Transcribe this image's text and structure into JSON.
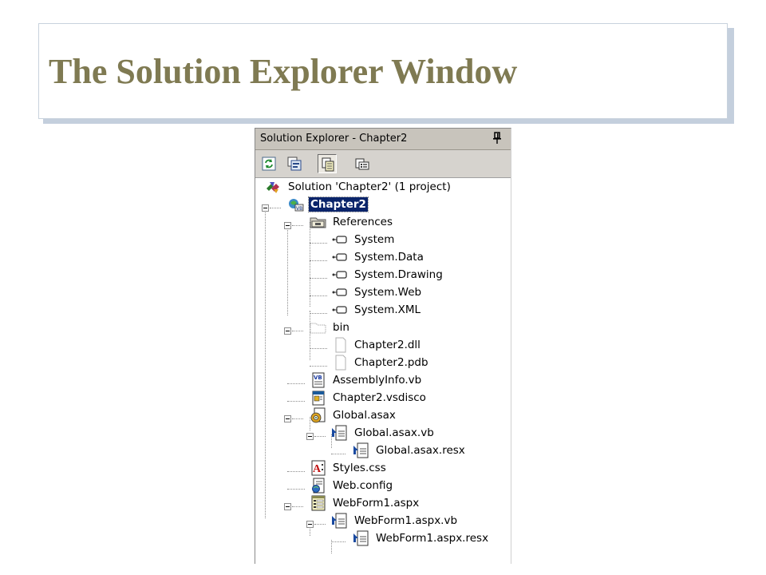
{
  "slide": {
    "title": "The Solution Explorer Window"
  },
  "window": {
    "title": "Solution Explorer - Chapter2",
    "toolbar": [
      {
        "name": "refresh-button",
        "icon": "refresh-icon",
        "active": false
      },
      {
        "name": "view-code-button",
        "icon": "view-code-icon",
        "active": false
      },
      {
        "name": "show-all-files-button",
        "icon": "show-all-files-icon",
        "active": true
      },
      {
        "name": "properties-button",
        "icon": "properties-icon",
        "active": false
      }
    ]
  },
  "tree": {
    "solution": "Solution 'Chapter2' (1 project)",
    "project": "Chapter2",
    "references": {
      "label": "References",
      "items": [
        "System",
        "System.Data",
        "System.Drawing",
        "System.Web",
        "System.XML"
      ]
    },
    "bin": {
      "label": "bin",
      "items": [
        "Chapter2.dll",
        "Chapter2.pdb"
      ]
    },
    "assemblyinfo": "AssemblyInfo.vb",
    "vsdisco": "Chapter2.vsdisco",
    "global": {
      "label": "Global.asax",
      "vb": "Global.asax.vb",
      "resx": "Global.asax.resx"
    },
    "styles": "Styles.css",
    "webconfig": "Web.config",
    "webform": {
      "label": "WebForm1.aspx",
      "vb": "WebForm1.aspx.vb",
      "resx": "WebForm1.aspx.resx"
    }
  }
}
